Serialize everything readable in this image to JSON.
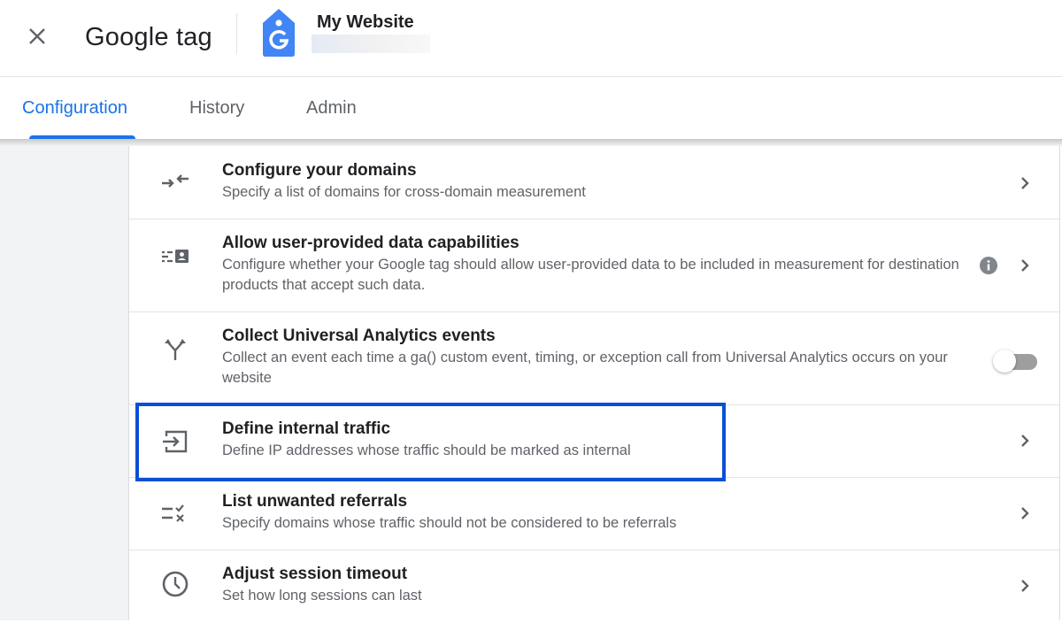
{
  "header": {
    "app_title": "Google tag",
    "site_name": "My Website",
    "close_icon": "close-icon",
    "logo_icon": "google-tag-icon"
  },
  "tabs": [
    {
      "label": "Configuration",
      "active": true
    },
    {
      "label": "History",
      "active": false
    },
    {
      "label": "Admin",
      "active": false
    }
  ],
  "settings": [
    {
      "icon": "cross-domain-arrows-icon",
      "title": "Configure your domains",
      "description": "Specify a list of domains for cross-domain measurement",
      "action": "chevron"
    },
    {
      "icon": "user-data-icon",
      "title": "Allow user-provided data capabilities",
      "description": "Configure whether your Google tag should allow user-provided data to be included in measurement for destination products that accept such data.",
      "action": "chevron",
      "has_info": true
    },
    {
      "icon": "fork-arrows-icon",
      "title": "Collect Universal Analytics events",
      "description": "Collect an event each time a ga() custom event, timing, or exception call from Universal Analytics occurs on your website",
      "action": "toggle",
      "toggle_on": false
    },
    {
      "icon": "login-icon",
      "title": "Define internal traffic",
      "description": "Define IP addresses whose traffic should be marked as internal",
      "action": "chevron",
      "highlighted": true
    },
    {
      "icon": "list-check-x-icon",
      "title": "List unwanted referrals",
      "description": "Specify domains whose traffic should not be considered to be referrals",
      "action": "chevron"
    },
    {
      "icon": "clock-icon",
      "title": "Adjust session timeout",
      "description": "Set how long sessions can last",
      "action": "chevron"
    }
  ],
  "colors": {
    "accent": "#1a73e8",
    "highlight_border": "#0b4fd6",
    "tag_logo": "#4285f4"
  }
}
